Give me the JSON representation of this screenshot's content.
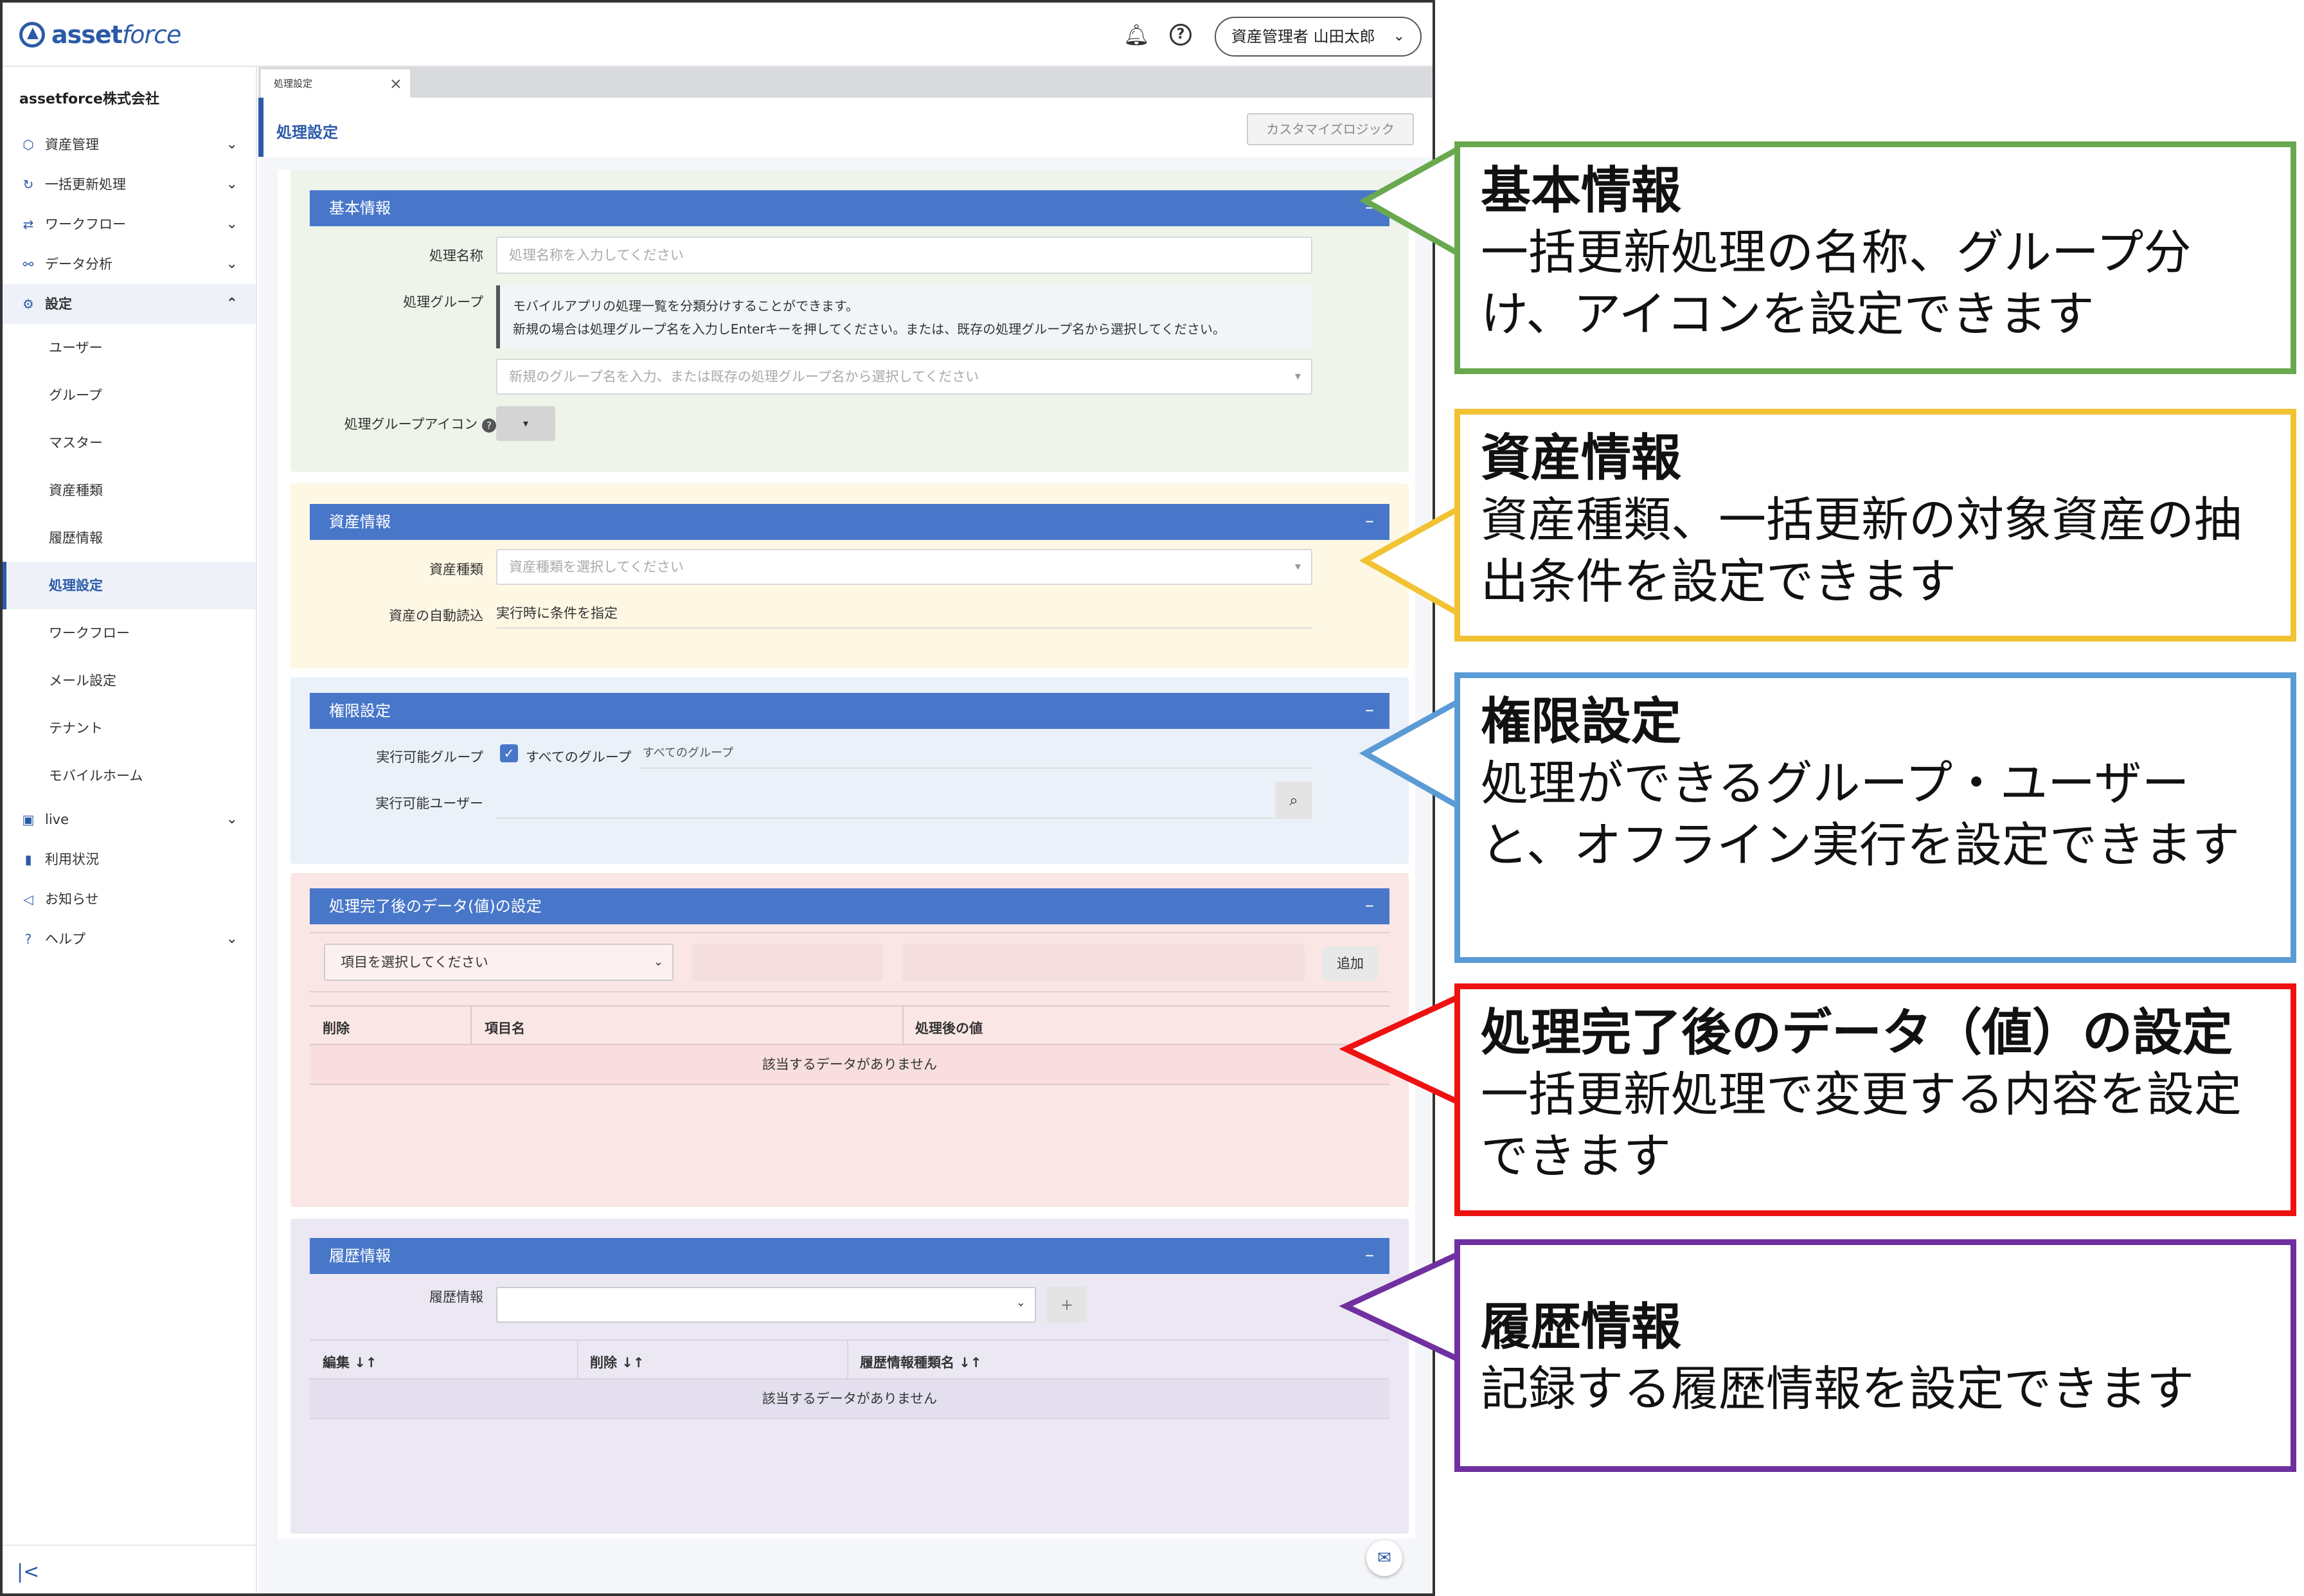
{
  "app": {
    "logo_text_a": "asset",
    "logo_text_b": "force",
    "user_menu": "資産管理者 山田太郎",
    "company": "assetforce株式会社"
  },
  "sidebar": {
    "items": [
      {
        "label": "資産管理",
        "icon": "cube-icon",
        "chevron": "⌄"
      },
      {
        "label": "一括更新処理",
        "icon": "refresh-icon",
        "chevron": "⌄"
      },
      {
        "label": "ワークフロー",
        "icon": "workflow-icon",
        "chevron": "⌄"
      },
      {
        "label": "データ分析",
        "icon": "analytics-icon",
        "chevron": "⌄"
      },
      {
        "label": "設定",
        "icon": "gear-icon",
        "chevron": "⌃"
      }
    ],
    "sub_items": [
      "ユーザー",
      "グループ",
      "マスター",
      "資産種類",
      "履歴情報",
      "処理設定",
      "ワークフロー",
      "メール設定",
      "テナント",
      "モバイルホーム"
    ],
    "bottom_items": [
      {
        "label": "live",
        "icon": "live-icon",
        "chevron": "⌄"
      },
      {
        "label": "利用状況",
        "icon": "bar-chart-icon",
        "chevron": ""
      },
      {
        "label": "お知らせ",
        "icon": "megaphone-icon",
        "chevron": ""
      },
      {
        "label": "ヘルプ",
        "icon": "help-icon",
        "chevron": "⌄"
      }
    ]
  },
  "main": {
    "tab_label": "処理設定",
    "page_title": "処理設定",
    "customize_button": "カスタマイズロジック",
    "basic": {
      "header": "基本情報",
      "name_label": "処理名称",
      "name_placeholder": "処理名称を入力してください",
      "group_label": "処理グループ",
      "group_hint_1": "モバイルアプリの処理一覧を分類分けすることができます。",
      "group_hint_2": "新規の場合は処理グループ名を入力しEnterキーを押してください。または、既存の処理グループ名から選択してください。",
      "group_placeholder": "新規のグループ名を入力、または既存の処理グループ名から選択してください",
      "icon_label": "処理グループアイコン"
    },
    "asset": {
      "header": "資産情報",
      "type_label": "資産種類",
      "type_placeholder": "資産種類を選択してください",
      "auto_label": "資産の自動読込",
      "auto_value": "実行時に条件を指定"
    },
    "perm": {
      "header": "権限設定",
      "group_label": "実行可能グループ",
      "all_groups": "すべてのグループ",
      "all_groups_tag": "すべてのグループ",
      "user_label": "実行可能ユーザー"
    },
    "after": {
      "header": "処理完了後のデータ(値)の設定",
      "select_placeholder": "項目を選択してください",
      "add_button": "追加",
      "columns": [
        "削除",
        "項目名",
        "処理後の値"
      ],
      "empty": "該当するデータがありません"
    },
    "history": {
      "header": "履歴情報",
      "label": "履歴情報",
      "add_button": "+",
      "columns": [
        "編集 ↓↑",
        "削除 ↓↑",
        "履歴情報種類名 ↓↑"
      ],
      "empty": "該当するデータがありません"
    }
  },
  "callouts": [
    {
      "title": "基本情報",
      "body": "一括更新処理の名称、グループ分け、アイコンを設定できます",
      "color": "#6aa84f"
    },
    {
      "title": "資産情報",
      "body": "資産種類、一括更新の対象資産の抽出条件を設定できます",
      "color": "#f1c232"
    },
    {
      "title": "権限設定",
      "body": "処理ができるグループ・ユーザーと、オフライン実行を設定できます",
      "color": "#5b9bd5"
    },
    {
      "title": "処理完了後のデータ（値）の設定",
      "body": "一括更新処理で変更する内容を設定できます",
      "color": "#ee1111"
    },
    {
      "title": "履歴情報",
      "body": "記録する履歴情報を設定できます",
      "color": "#7030a0"
    }
  ]
}
